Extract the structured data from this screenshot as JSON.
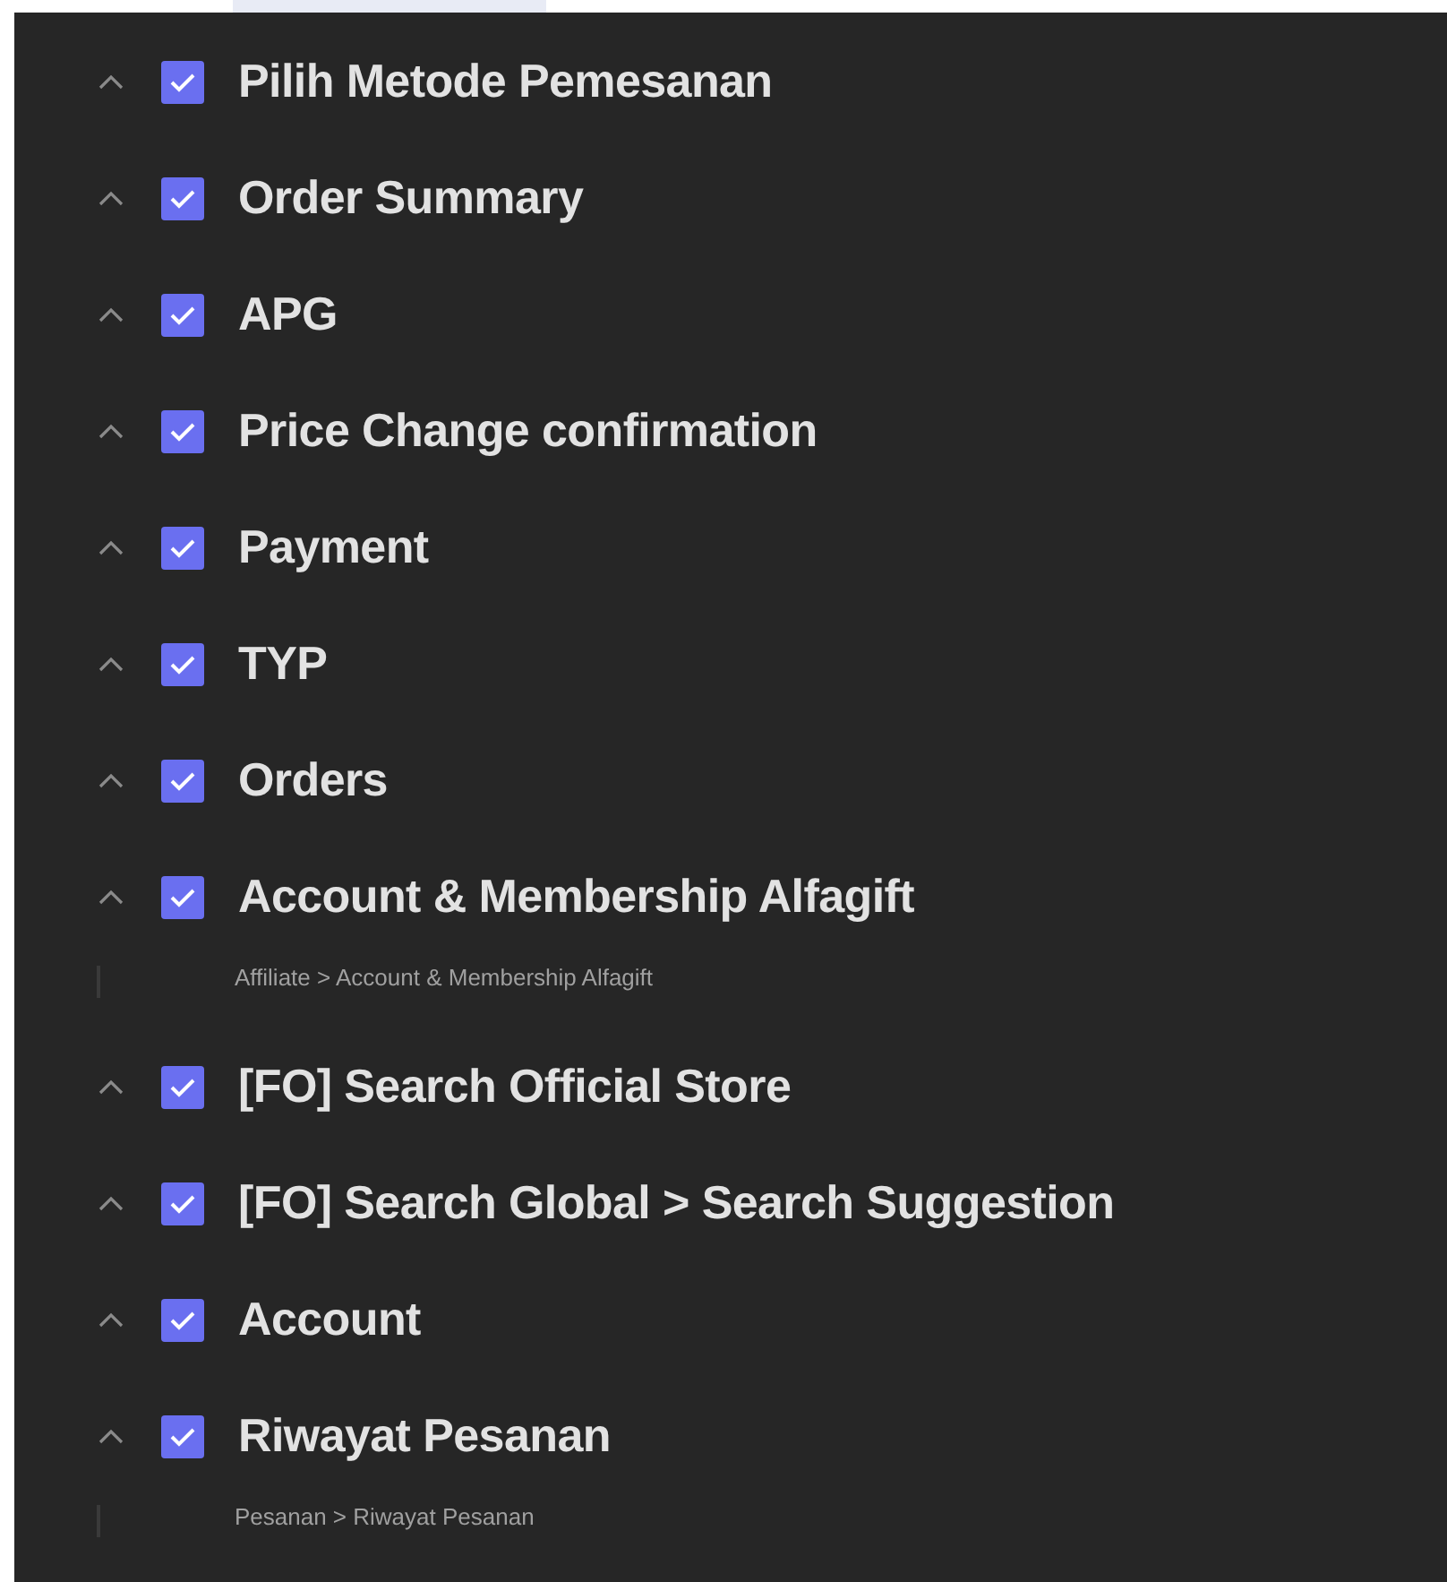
{
  "items": [
    {
      "title": "Pilih Metode Pemesanan",
      "checked": true,
      "expanded": true
    },
    {
      "title": "Order Summary",
      "checked": true,
      "expanded": true
    },
    {
      "title": "APG",
      "checked": true,
      "expanded": true
    },
    {
      "title": "Price Change confirmation",
      "checked": true,
      "expanded": true
    },
    {
      "title": "Payment",
      "checked": true,
      "expanded": true
    },
    {
      "title": "TYP",
      "checked": true,
      "expanded": true
    },
    {
      "title": "Orders",
      "checked": true,
      "expanded": true
    },
    {
      "title": "Account & Membership Alfagift",
      "checked": true,
      "expanded": true,
      "path": "Affiliate > Account & Membership Alfagift"
    },
    {
      "title": "[FO] Search Official Store",
      "checked": true,
      "expanded": true
    },
    {
      "title": "[FO] Search Global > Search Suggestion",
      "checked": true,
      "expanded": true
    },
    {
      "title": "Account",
      "checked": true,
      "expanded": true
    },
    {
      "title": "Riwayat Pesanan",
      "checked": true,
      "expanded": true,
      "path": "Pesanan > Riwayat Pesanan"
    }
  ]
}
